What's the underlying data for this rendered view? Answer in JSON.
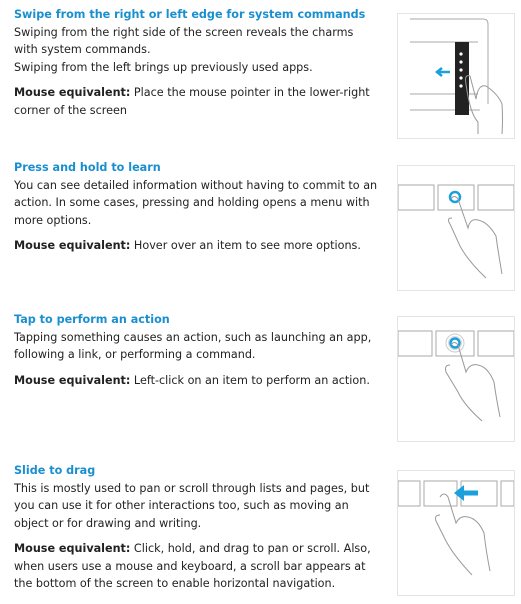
{
  "sections": [
    {
      "heading": "Swipe from the right or left edge for system commands",
      "body": [
        "Swiping from the right side of the screen reveals the charms with system commands.",
        "Swiping from the left brings up previously used apps."
      ],
      "mouse_label": "Mouse equivalent:",
      "mouse_text": " Place the mouse pointer in the lower-right corner of the screen",
      "illustration": "swipe-edge"
    },
    {
      "heading": "Press and hold to learn",
      "body": [
        "You can see detailed information without having to commit to an action. In some cases, pressing and holding opens a menu with more options."
      ],
      "mouse_label": "Mouse equivalent:",
      "mouse_text": " Hover over an item to see more options.",
      "illustration": "press-hold"
    },
    {
      "heading": "Tap to perform an action",
      "body": [
        "Tapping something causes an action, such as launching an app, following a link, or performing a command."
      ],
      "mouse_label": "Mouse equivalent:",
      "mouse_text": " Left-click on an item to perform an action.",
      "illustration": "tap"
    },
    {
      "heading": "Slide to drag",
      "body": [
        "This is mostly used to pan or scroll through lists and pages, but you can use it for other interactions too, such as moving an object or for drawing and writing."
      ],
      "mouse_label": "Mouse equivalent:",
      "mouse_text": " Click, hold, and drag to pan or scroll. Also, when users use a mouse and keyboard, a scroll bar appears at the bottom of the screen to enable horizontal navigation.",
      "illustration": "slide"
    }
  ],
  "colors": {
    "heading": "#1a8fd0",
    "accent": "#1aa0dc"
  }
}
